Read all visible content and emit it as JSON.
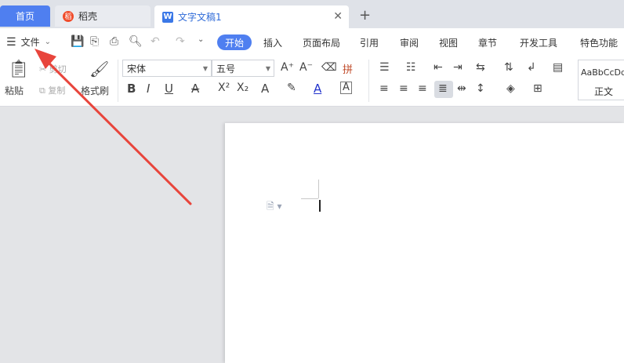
{
  "tabs": {
    "home": "首页",
    "daoke": "稻壳",
    "doc": "文字文稿1",
    "new_tab": "+"
  },
  "menubar": {
    "file": "文件",
    "active_tab": "开始",
    "items": [
      "插入",
      "页面布局",
      "引用",
      "审阅",
      "视图",
      "章节",
      "开发工具",
      "特色功能"
    ]
  },
  "ribbon": {
    "paste": "粘贴",
    "cut": "剪切",
    "copy": "复制",
    "format_painter": "格式刷",
    "font_name": "宋体",
    "font_size": "五号",
    "style_preview": "AaBbCcDd",
    "style_name": "正文"
  },
  "colors": {
    "accent": "#4f7ff0",
    "annotation_arrow": "#e8453c"
  }
}
